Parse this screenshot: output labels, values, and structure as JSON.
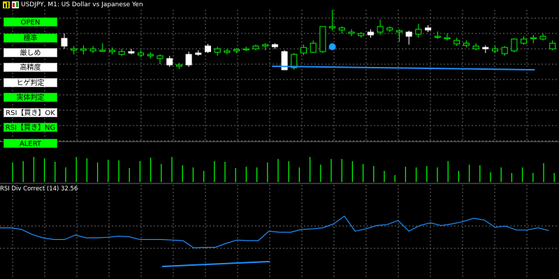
{
  "header": {
    "symbol_line": "USDJPY, M1:  US Dollar vs Japanese Yen"
  },
  "indicator": {
    "title": "RSI Div Correct (14) 32.56"
  },
  "panel_buttons": [
    {
      "label": "OPEN",
      "state": "on"
    },
    {
      "label": "標準",
      "state": "on"
    },
    {
      "label": "厳しめ",
      "state": "off"
    },
    {
      "label": "高精度",
      "state": "off"
    },
    {
      "label": "ヒゲ判定",
      "state": "off"
    },
    {
      "label": "実体判定",
      "state": "on"
    },
    {
      "label": "RSI【買き】OK",
      "state": "off"
    },
    {
      "label": "RSI【買き】NG",
      "state": "on"
    },
    {
      "label": "ALERT",
      "state": "on"
    }
  ],
  "colors": {
    "background": "#000000",
    "grid": "#6b6b6b",
    "bull_candle": "#ffffff",
    "bear_candle": "#00ff00",
    "divergence_line": "#1e90ff",
    "rsi_line": "#1e90ff",
    "volume_bar": "#00ff00",
    "signal_dot": "#1ea0ff",
    "button_on": "#00ff00",
    "button_off": "#ffffff"
  },
  "chart_data": {
    "type": "candlestick",
    "candles": [
      {
        "o": 55,
        "h": 48,
        "l": 70,
        "c": 66,
        "bull": true
      },
      {
        "o": 70,
        "h": 66,
        "l": 78,
        "c": 72,
        "bull": false
      },
      {
        "o": 72,
        "h": 65,
        "l": 78,
        "c": 70,
        "bull": false
      },
      {
        "o": 70,
        "h": 66,
        "l": 76,
        "c": 73,
        "bull": false
      },
      {
        "o": 72,
        "h": 62,
        "l": 74,
        "c": 72,
        "bull": false
      },
      {
        "o": 72,
        "h": 68,
        "l": 78,
        "c": 74,
        "bull": false
      },
      {
        "o": 74,
        "h": 70,
        "l": 80,
        "c": 78,
        "bull": false
      },
      {
        "o": 74,
        "h": 70,
        "l": 78,
        "c": 76,
        "bull": true
      },
      {
        "o": 76,
        "h": 72,
        "l": 82,
        "c": 79,
        "bull": false
      },
      {
        "o": 78,
        "h": 75,
        "l": 84,
        "c": 80,
        "bull": false
      },
      {
        "o": 80,
        "h": 78,
        "l": 92,
        "c": 84,
        "bull": false
      },
      {
        "o": 84,
        "h": 80,
        "l": 96,
        "c": 93,
        "bull": true
      },
      {
        "o": 93,
        "h": 90,
        "l": 99,
        "c": 95,
        "bull": false
      },
      {
        "o": 93,
        "h": 74,
        "l": 96,
        "c": 78,
        "bull": true
      },
      {
        "o": 78,
        "h": 72,
        "l": 80,
        "c": 76,
        "bull": true
      },
      {
        "o": 74,
        "h": 63,
        "l": 76,
        "c": 66,
        "bull": true
      },
      {
        "o": 70,
        "h": 67,
        "l": 80,
        "c": 75,
        "bull": false
      },
      {
        "o": 73,
        "h": 70,
        "l": 78,
        "c": 75,
        "bull": false
      },
      {
        "o": 73,
        "h": 69,
        "l": 76,
        "c": 71,
        "bull": false
      },
      {
        "o": 70,
        "h": 67,
        "l": 73,
        "c": 71,
        "bull": false
      },
      {
        "o": 70,
        "h": 64,
        "l": 72,
        "c": 66,
        "bull": false
      },
      {
        "o": 66,
        "h": 62,
        "l": 72,
        "c": 64,
        "bull": false
      },
      {
        "o": 64,
        "h": 62,
        "l": 70,
        "c": 67,
        "bull": true
      },
      {
        "o": 74,
        "h": 72,
        "l": 100,
        "c": 100,
        "bull": true
      },
      {
        "o": 78,
        "h": 76,
        "l": 100,
        "c": 97,
        "bull": false
      },
      {
        "o": 76,
        "h": 64,
        "l": 79,
        "c": 68,
        "bull": false
      },
      {
        "o": 75,
        "h": 58,
        "l": 76,
        "c": 62,
        "bull": false
      },
      {
        "o": 74,
        "h": 38,
        "l": 76,
        "c": 38,
        "bull": false
      },
      {
        "o": 38,
        "h": 14,
        "l": 44,
        "c": 40,
        "bull": false
      },
      {
        "o": 40,
        "h": 38,
        "l": 48,
        "c": 43,
        "bull": false
      },
      {
        "o": 46,
        "h": 42,
        "l": 52,
        "c": 48,
        "bull": false
      },
      {
        "o": 48,
        "h": 46,
        "l": 54,
        "c": 51,
        "bull": false
      },
      {
        "o": 50,
        "h": 42,
        "l": 54,
        "c": 46,
        "bull": true
      },
      {
        "o": 46,
        "h": 28,
        "l": 50,
        "c": 38,
        "bull": false
      },
      {
        "o": 40,
        "h": 38,
        "l": 46,
        "c": 43,
        "bull": false
      },
      {
        "o": 44,
        "h": 42,
        "l": 60,
        "c": 46,
        "bull": false
      },
      {
        "o": 52,
        "h": 44,
        "l": 64,
        "c": 46,
        "bull": true
      },
      {
        "o": 42,
        "h": 34,
        "l": 54,
        "c": 49,
        "bull": false
      },
      {
        "o": 43,
        "h": 36,
        "l": 46,
        "c": 40,
        "bull": true
      },
      {
        "o": 52,
        "h": 45,
        "l": 56,
        "c": 53,
        "bull": false
      },
      {
        "o": 54,
        "h": 48,
        "l": 58,
        "c": 55,
        "bull": false
      },
      {
        "o": 58,
        "h": 54,
        "l": 66,
        "c": 63,
        "bull": false
      },
      {
        "o": 62,
        "h": 58,
        "l": 68,
        "c": 65,
        "bull": false
      },
      {
        "o": 66,
        "h": 62,
        "l": 72,
        "c": 70,
        "bull": false
      },
      {
        "o": 70,
        "h": 65,
        "l": 76,
        "c": 68,
        "bull": true
      },
      {
        "o": 70,
        "h": 66,
        "l": 76,
        "c": 73,
        "bull": false
      },
      {
        "o": 68,
        "h": 66,
        "l": 80,
        "c": 77,
        "bull": false
      },
      {
        "o": 73,
        "h": 55,
        "l": 75,
        "c": 56,
        "bull": false
      },
      {
        "o": 62,
        "h": 52,
        "l": 64,
        "c": 56,
        "bull": false
      },
      {
        "o": 54,
        "h": 50,
        "l": 62,
        "c": 55,
        "bull": false
      },
      {
        "o": 56,
        "h": 48,
        "l": 58,
        "c": 52,
        "bull": false
      },
      {
        "o": 62,
        "h": 58,
        "l": 72,
        "c": 70,
        "bull": false
      }
    ],
    "volumes": [
      28,
      30,
      36,
      34,
      29,
      21,
      36,
      34,
      28,
      32,
      31,
      20,
      30,
      35,
      26,
      36,
      24,
      21,
      16,
      30,
      29,
      20,
      22,
      21,
      28,
      33,
      30,
      21,
      36,
      25,
      33,
      33,
      30,
      26,
      23,
      16,
      10,
      22,
      21,
      23,
      21,
      30,
      16,
      25,
      24,
      14,
      21,
      13,
      21,
      13,
      27,
      13
    ],
    "rsi": [
      72,
      72,
      75,
      84,
      90,
      93,
      93,
      85,
      90,
      90,
      89,
      87,
      88,
      93,
      93,
      93,
      94,
      95,
      108,
      107,
      107,
      100,
      94,
      95,
      95,
      78,
      80,
      80,
      75,
      74,
      72,
      65,
      51,
      78,
      74,
      68,
      66,
      59,
      78,
      68,
      63,
      68,
      65,
      61,
      55,
      58,
      71,
      69,
      76,
      76,
      72,
      77
    ],
    "bearish_divergence_price": {
      "from_index": 22,
      "to_index": 49
    },
    "rsi_divergence_line": {
      "from_index": 22,
      "to_index": 49
    },
    "signal_dot_index": 28
  }
}
